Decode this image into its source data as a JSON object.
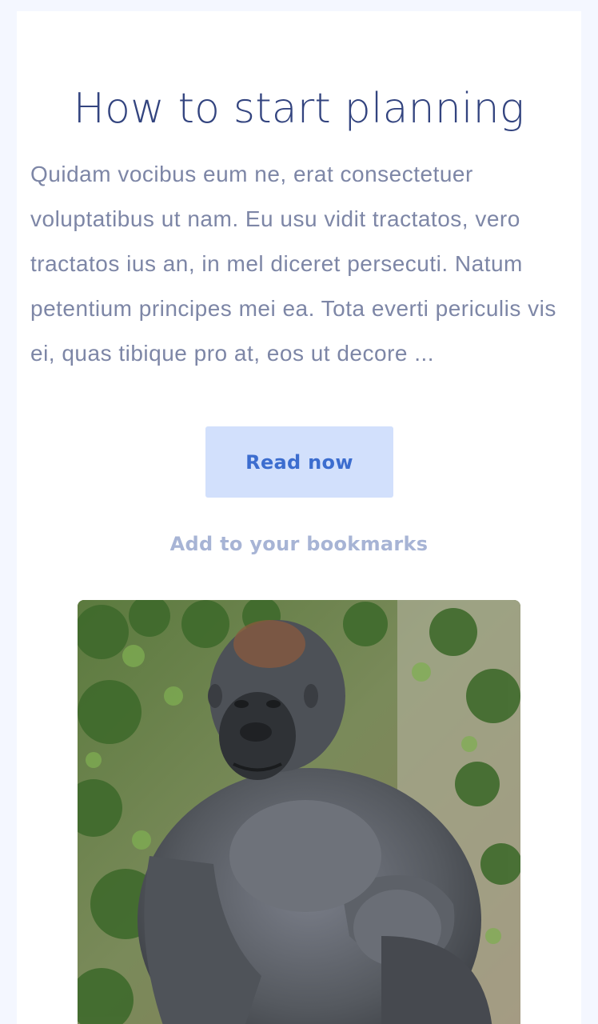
{
  "article": {
    "title": "How to start planning",
    "excerpt": "Quidam vocibus eum ne, erat consectetuer voluptatibus ut nam. Eu usu vidit tractatos, vero tractatos ius an, in mel diceret persecuti. Natum petentium principes mei ea. Tota everti periculis vis ei, quas tibique pro at, eos ut decore ...",
    "read_label": "Read now",
    "bookmark_label": "Add to your bookmarks",
    "image_subject": "gorilla"
  },
  "colors": {
    "page_bg": "#f4f7ff",
    "card_bg": "#ffffff",
    "title": "#33447f",
    "body_text": "#7d86a6",
    "button_bg": "#d2e0fc",
    "button_text": "#3c6dcf",
    "link_text": "#a7b4d5"
  }
}
